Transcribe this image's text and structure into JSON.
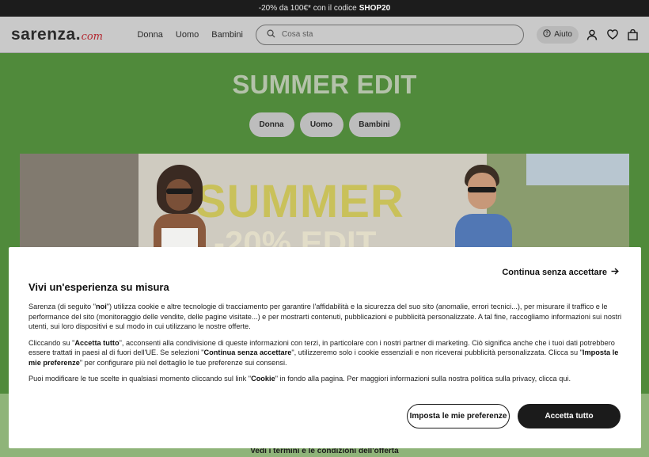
{
  "promo": {
    "text": "-20% da 100€* con il codice",
    "code": "SHOP20"
  },
  "header": {
    "logo_main": "sarenza",
    "logo_dot": ".",
    "logo_com": "com",
    "nav": [
      "Donna",
      "Uomo",
      "Bambini"
    ],
    "search_placeholder": "Cosa sta",
    "help_label": "Aiuto",
    "icons": [
      "search-icon",
      "help-circle-icon",
      "user-icon",
      "heart-icon",
      "bag-icon"
    ]
  },
  "hero": {
    "title": "SUMMER EDIT",
    "pills": [
      "Donna",
      "Uomo",
      "Bambini"
    ],
    "banner_word_1": "SUMMER",
    "banner_word_2": "-20% EDIT",
    "terms_link": "Vedi i termini e le condizioni dell'offerta"
  },
  "cookie_banner": {
    "skip_label": "Continua senza accettare",
    "title": "Vivi un'esperienza su misura",
    "p1_a": "Sarenza (di seguito \"",
    "p1_bold": "noi",
    "p1_b": "\") utilizza cookie e altre tecnologie di tracciamento per garantire l'affidabilità e la sicurezza del suo sito (anomalie, errori tecnici...), per misurare il traffico e le performance del sito (monitoraggio delle vendite, delle pagine visitate...) e per mostrarti contenuti, pubblicazioni e pubblicità personalizzate. A tal fine, raccogliamo informazioni sui nostri utenti, sui loro dispositivi e sul modo in cui utilizzano le nostre offerte.",
    "p2_a": "Cliccando su \"",
    "p2_bold1": "Accetta tutto",
    "p2_b": "\", acconsenti alla condivisione di queste informazioni con terzi, in particolare con i nostri partner di marketing. Ciò significa anche che i tuoi dati potrebbero essere trattati in paesi al di fuori dell'UE. Se selezioni \"",
    "p2_bold2": "Continua senza accettare",
    "p2_c": "\", utilizzeremo solo i cookie essenziali e non riceverai pubblicità personalizzata. Clicca su \"",
    "p2_bold3": "Imposta le mie preferenze",
    "p2_d": "\" per configurare più nel dettaglio le tue preferenze sui consensi.",
    "p3_a": "Puoi modificare le tue scelte in qualsiasi momento cliccando sul link \"",
    "p3_bold": "Cookie",
    "p3_b": "\" in fondo alla pagina. Per maggiori informazioni sulla nostra politica sulla privacy, clicca qui.",
    "btn_preferences": "Imposta le mie preferenze",
    "btn_accept": "Accetta tutto"
  }
}
